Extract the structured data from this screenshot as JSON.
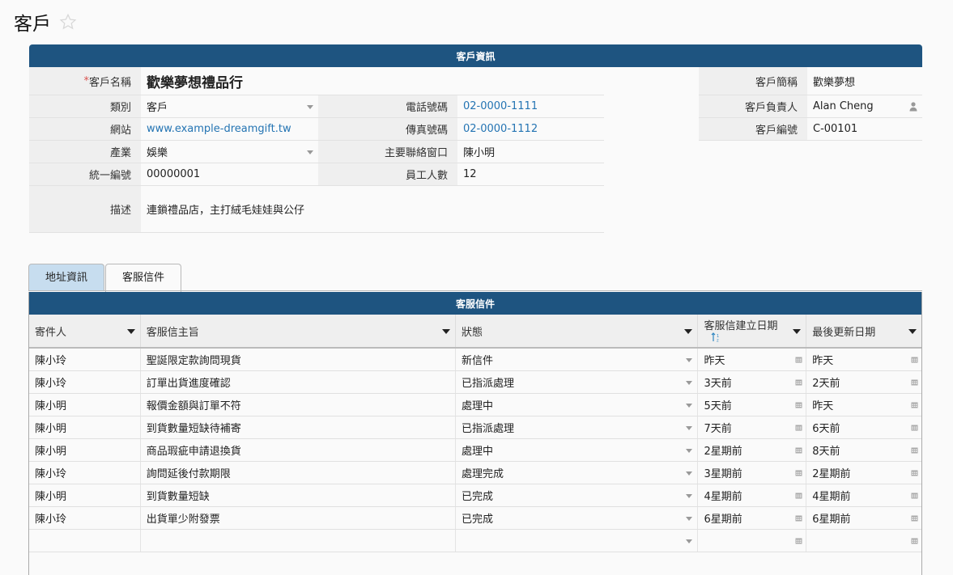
{
  "page": {
    "title": "客戶"
  },
  "card": {
    "header": "客戶資訊"
  },
  "fields": {
    "name_label": "客戶名稱",
    "name_value": "歡樂夢想禮品行",
    "short_label": "客戶簡稱",
    "short_value": "歡樂夢想",
    "type_label": "類別",
    "type_value": "客戶",
    "phone_label": "電話號碼",
    "phone_value": "02-0000-1111",
    "owner_label": "客戶負責人",
    "owner_value": "Alan Cheng",
    "website_label": "網站",
    "website_value": "www.example-dreamgift.tw",
    "fax_label": "傳真號碼",
    "fax_value": "02-0000-1112",
    "code_label": "客戶編號",
    "code_value": "C-00101",
    "industry_label": "產業",
    "industry_value": "娛樂",
    "contact_label": "主要聯絡窗口",
    "contact_value": "陳小明",
    "taxid_label": "統一編號",
    "taxid_value": "00000001",
    "employees_label": "員工人數",
    "employees_value": "12",
    "desc_label": "描述",
    "desc_value": "連鎖禮品店，主打絨毛娃娃與公仔"
  },
  "tabs": [
    {
      "label": "地址資訊"
    },
    {
      "label": "客服信件"
    }
  ],
  "grid": {
    "title": "客服信件",
    "columns": [
      "寄件人",
      "客服信主旨",
      "狀態",
      "客服信建立日期",
      "最後更新日期"
    ],
    "rows": [
      {
        "sender": "陳小玲",
        "subject": "聖誕限定款詢問現貨",
        "status": "新信件",
        "created": "昨天",
        "updated": "昨天"
      },
      {
        "sender": "陳小玲",
        "subject": "訂單出貨進度確認",
        "status": "已指派處理",
        "created": "3天前",
        "updated": "2天前"
      },
      {
        "sender": "陳小明",
        "subject": "報價金額與訂單不符",
        "status": "處理中",
        "created": "5天前",
        "updated": "昨天"
      },
      {
        "sender": "陳小明",
        "subject": "到貨數量短缺待補寄",
        "status": "已指派處理",
        "created": "7天前",
        "updated": "6天前"
      },
      {
        "sender": "陳小明",
        "subject": "商品瑕疵申請退換貨",
        "status": "處理中",
        "created": "2星期前",
        "updated": "8天前"
      },
      {
        "sender": "陳小玲",
        "subject": "詢問延後付款期限",
        "status": "處理完成",
        "created": "3星期前",
        "updated": "2星期前"
      },
      {
        "sender": "陳小明",
        "subject": "到貨數量短缺",
        "status": "已完成",
        "created": "4星期前",
        "updated": "4星期前"
      },
      {
        "sender": "陳小玲",
        "subject": "出貨單少附發票",
        "status": "已完成",
        "created": "6星期前",
        "updated": "6星期前"
      }
    ]
  },
  "colors": {
    "header": "#1e5480",
    "link": "#2474b3",
    "tab_inactive": "#c7ddef"
  }
}
